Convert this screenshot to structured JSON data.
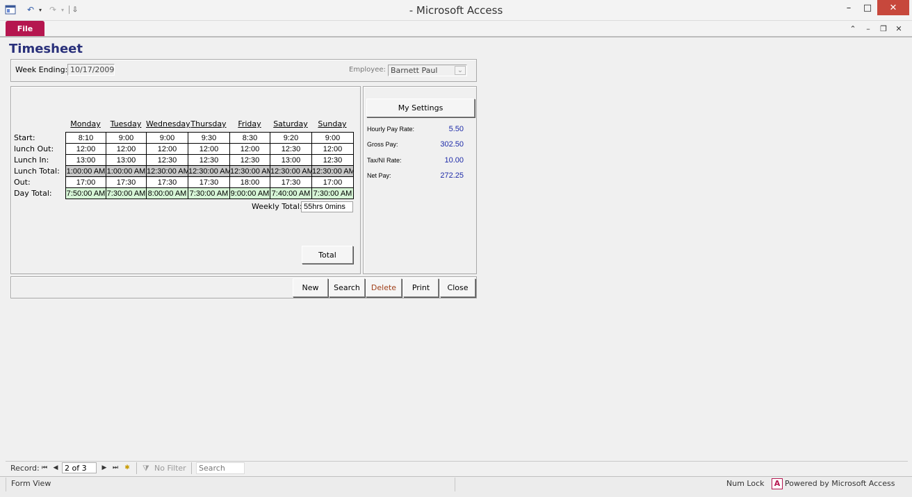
{
  "window": {
    "title": "-  Microsoft Access"
  },
  "qat": {
    "app_icon": "access-window-icon",
    "undo_icon": "undo-icon",
    "redo_icon": "redo-icon",
    "customize_icon": "customize-qat-icon",
    "dropdown_glyph": "▾",
    "undo_glyph": "↶",
    "redo_glyph": "↷",
    "customize_glyph": "⇩"
  },
  "window_controls": {
    "minimize": "–",
    "maximize": "□",
    "close": "✕"
  },
  "ribbon": {
    "file_label": "File",
    "collapse": "⌃",
    "mdi_minimize": "–",
    "mdi_restore": "❐",
    "mdi_close": "✕"
  },
  "form": {
    "title": "Timesheet",
    "week_ending_label": "Week Ending:",
    "week_ending_value": "10/17/2009",
    "employee_label": "Employee:",
    "employee_value": "Barnett Paul",
    "dropdown_glyph": "⌄",
    "days": [
      "Monday",
      "Tuesday",
      "Wednesday",
      "Thursday",
      "Friday",
      "Saturday",
      "Sunday"
    ],
    "rows": [
      {
        "label": "Start:",
        "style": "white",
        "values": [
          "8:10",
          "9:00",
          "9:00",
          "9:30",
          "8:30",
          "9:20",
          "9:00"
        ]
      },
      {
        "label": "lunch Out:",
        "style": "white",
        "values": [
          "12:00",
          "12:00",
          "12:00",
          "12:00",
          "12:00",
          "12:30",
          "12:00"
        ]
      },
      {
        "label": "Lunch In:",
        "style": "white",
        "values": [
          "13:00",
          "13:00",
          "12:30",
          "12:30",
          "12:30",
          "13:00",
          "12:30"
        ]
      },
      {
        "label": "Lunch Total:",
        "style": "gray",
        "values": [
          "1:00:00 AM",
          "1:00:00 AM",
          "12:30:00 AM",
          "12:30:00 AM",
          "12:30:00 AM",
          "12:30:00 AM",
          "12:30:00 AM"
        ]
      },
      {
        "label": "Out:",
        "style": "white",
        "values": [
          "17:00",
          "17:30",
          "17:30",
          "17:30",
          "18:00",
          "17:30",
          "17:00"
        ]
      },
      {
        "label": "Day Total:",
        "style": "green",
        "values": [
          "7:50:00 AM",
          "7:30:00 AM",
          "8:00:00 AM",
          "7:30:00 AM",
          "9:00:00 AM",
          "7:40:00 AM",
          "7:30:00 AM"
        ]
      }
    ],
    "weekly_total_label": "Weekly Total:",
    "weekly_total_value": "55hrs 0mins",
    "total_button": "Total"
  },
  "settings": {
    "button": "My Settings",
    "items": [
      {
        "label": "Hourly Pay Rate:",
        "value": "5.50"
      },
      {
        "label": "Gross Pay:",
        "value": "302.50"
      },
      {
        "label": "Tax/NI Rate:",
        "value": "10.00"
      },
      {
        "label": "Net Pay:",
        "value": "272.25"
      }
    ]
  },
  "actions": {
    "new": "New",
    "search": "Search",
    "delete": "Delete",
    "print": "Print",
    "close": "Close"
  },
  "record_nav": {
    "record_label": "Record:",
    "position": "2 of 3",
    "first": "⏮",
    "prev": "◀",
    "next": "▶",
    "last": "⏭",
    "new": "✱",
    "filter_glyph": "⧩",
    "filter": "No Filter",
    "search_placeholder": "Search"
  },
  "status": {
    "view": "Form View",
    "num_lock": "Num Lock",
    "powered_glyph": "A",
    "powered": "Powered by Microsoft Access"
  },
  "colors": {
    "file_tab": "#b5164f",
    "title": "#29307a",
    "settings_value": "#1d2aa8",
    "delete": "#a0401a",
    "close_button": "#c7483c"
  }
}
